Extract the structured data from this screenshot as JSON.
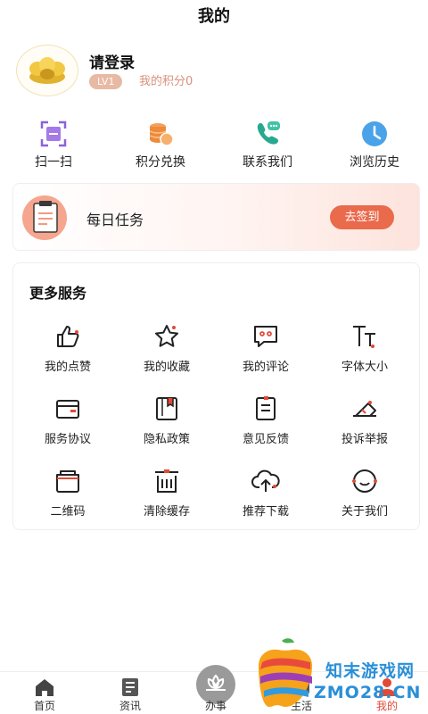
{
  "header": {
    "title": "我的"
  },
  "profile": {
    "login_label": "请登录",
    "level_badge": "LV1",
    "points_text": "我的积分0"
  },
  "quick_actions": [
    {
      "label": "扫一扫",
      "icon": "scan-icon"
    },
    {
      "label": "积分兑换",
      "icon": "coins-icon"
    },
    {
      "label": "联系我们",
      "icon": "phone-icon"
    },
    {
      "label": "浏览历史",
      "icon": "clock-icon"
    }
  ],
  "daily_task": {
    "label": "每日任务",
    "button_label": "去签到",
    "icon": "clipboard-icon"
  },
  "services": {
    "title": "更多服务",
    "items": [
      {
        "label": "我的点赞",
        "icon": "thumbs-up-icon"
      },
      {
        "label": "我的收藏",
        "icon": "star-icon"
      },
      {
        "label": "我的评论",
        "icon": "comment-icon"
      },
      {
        "label": "字体大小",
        "icon": "font-size-icon"
      },
      {
        "label": "服务协议",
        "icon": "card-icon"
      },
      {
        "label": "隐私政策",
        "icon": "bookmark-icon"
      },
      {
        "label": "意见反馈",
        "icon": "feedback-icon"
      },
      {
        "label": "投诉举报",
        "icon": "report-icon"
      },
      {
        "label": "二维码",
        "icon": "qrcode-icon"
      },
      {
        "label": "清除缓存",
        "icon": "trash-icon"
      },
      {
        "label": "推荐下载",
        "icon": "cloud-upload-icon"
      },
      {
        "label": "关于我们",
        "icon": "smile-icon"
      }
    ]
  },
  "tabbar": {
    "items": [
      {
        "label": "首页",
        "icon": "home-icon"
      },
      {
        "label": "资讯",
        "icon": "news-icon"
      },
      {
        "label": "办事",
        "icon": "lotus-icon"
      },
      {
        "label": "生活",
        "icon": "life-icon"
      },
      {
        "label": "我的",
        "icon": "user-icon"
      }
    ]
  },
  "watermark": {
    "line1": "知末游戏网",
    "line2": "ZMO28.CN"
  },
  "colors": {
    "accent": "#ea6a4c",
    "active_tab": "#e14a37",
    "watermark": "#2a8fd8"
  }
}
